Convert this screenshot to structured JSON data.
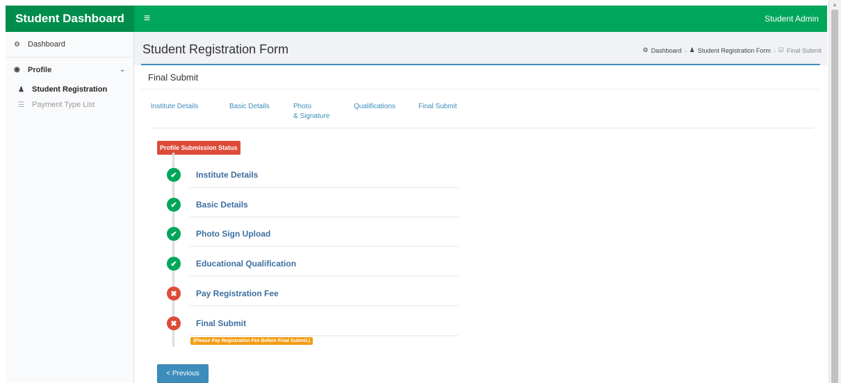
{
  "topbar": {
    "brand": "Student Dashboard",
    "menu_icon": "≡",
    "user": "Student Admin"
  },
  "sidebar": {
    "dashboard": "Dashboard",
    "profile": "Profile",
    "items": [
      {
        "label": "Student Registration",
        "icon": "user-icon"
      },
      {
        "label": "Payment Type List",
        "icon": "list-icon"
      }
    ]
  },
  "header": {
    "title": "Student Registration Form",
    "breadcrumb": [
      "Dashboard",
      "Student Registration Form",
      "Final Submit"
    ]
  },
  "box": {
    "title": "Final Submit",
    "tabs": [
      {
        "label": "Institute Details"
      },
      {
        "label": "Basic Details"
      },
      {
        "line1": "Photo",
        "line2": "& Signature"
      },
      {
        "label": "Qualifications"
      },
      {
        "label": "Final Submit"
      }
    ]
  },
  "status": {
    "badge": "Profile Submission Status",
    "steps": [
      {
        "label": "Institute Details",
        "state": "complete"
      },
      {
        "label": "Basic Details",
        "state": "complete"
      },
      {
        "label": "Photo Sign Upload",
        "state": "complete"
      },
      {
        "label": "Educational Qualification",
        "state": "complete"
      },
      {
        "label": "Pay Registration Fee",
        "state": "incomplete"
      },
      {
        "label": "Final Submit",
        "state": "incomplete"
      }
    ],
    "note": "(Please Pay Registration Fee Before Final Submit.)"
  },
  "buttons": {
    "previous": "< Previous"
  },
  "colors": {
    "brand_green": "#00a65a",
    "dark_green": "#008d4c",
    "primary_blue": "#3c8dbc",
    "danger_red": "#dd4b39",
    "warning_orange": "#f39c12"
  }
}
